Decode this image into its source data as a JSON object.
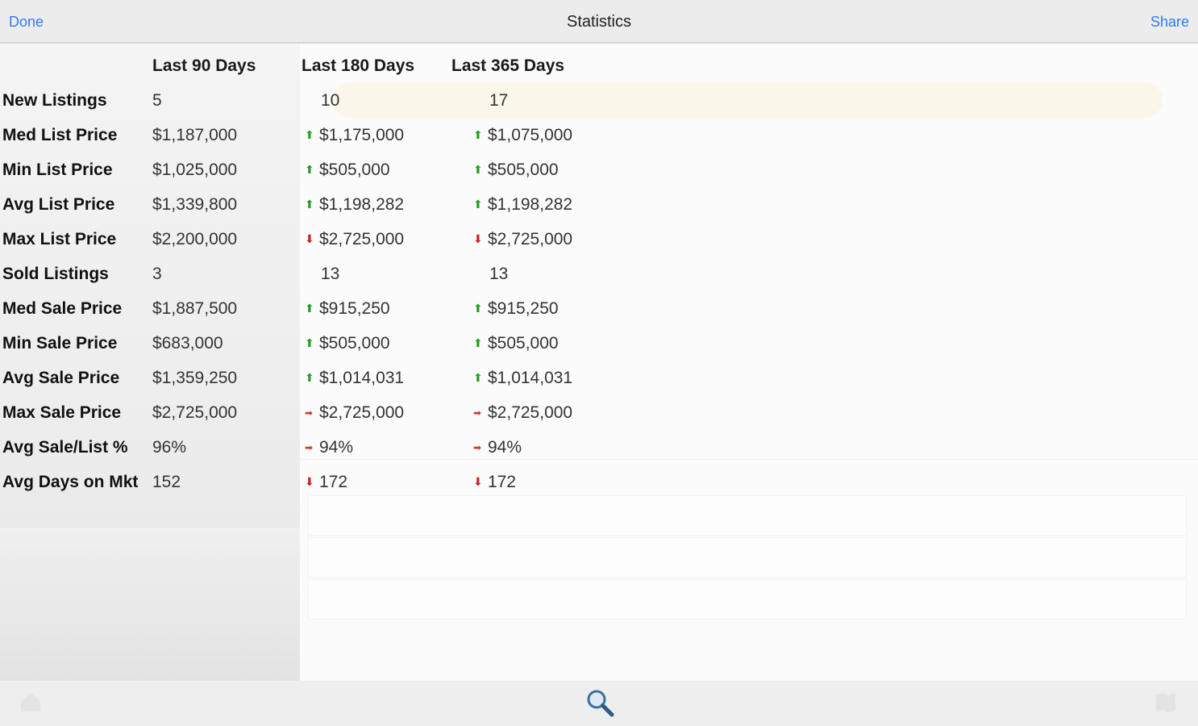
{
  "navbar": {
    "done_label": "Done",
    "title": "Statistics",
    "share_label": "Share",
    "accent_color": "#2f7cf6"
  },
  "stats": {
    "columns": [
      "Last 90 Days",
      "Last 180 Days",
      "Last 365 Days"
    ],
    "rows": [
      {
        "label": "New Listings",
        "d90": "5",
        "d180": "10",
        "d365": "17",
        "t180": "none",
        "t365": "none"
      },
      {
        "label": "Med List Price",
        "d90": "$1,187,000",
        "d180": "$1,175,000",
        "d365": "$1,075,000",
        "t180": "up",
        "t365": "up"
      },
      {
        "label": "Min List Price",
        "d90": "$1,025,000",
        "d180": "$505,000",
        "d365": "$505,000",
        "t180": "up",
        "t365": "up"
      },
      {
        "label": "Avg List Price",
        "d90": "$1,339,800",
        "d180": "$1,198,282",
        "d365": "$1,198,282",
        "t180": "up",
        "t365": "up"
      },
      {
        "label": "Max List Price",
        "d90": "$2,200,000",
        "d180": "$2,725,000",
        "d365": "$2,725,000",
        "t180": "down",
        "t365": "down"
      },
      {
        "label": "Sold Listings",
        "d90": "3",
        "d180": "13",
        "d365": "13",
        "t180": "none",
        "t365": "none"
      },
      {
        "label": "Med Sale Price",
        "d90": "$1,887,500",
        "d180": "$915,250",
        "d365": "$915,250",
        "t180": "up",
        "t365": "up"
      },
      {
        "label": "Min Sale Price",
        "d90": "$683,000",
        "d180": "$505,000",
        "d365": "$505,000",
        "t180": "up",
        "t365": "up"
      },
      {
        "label": "Avg Sale Price",
        "d90": "$1,359,250",
        "d180": "$1,014,031",
        "d365": "$1,014,031",
        "t180": "up",
        "t365": "up"
      },
      {
        "label": "Max Sale Price",
        "d90": "$2,725,000",
        "d180": "$2,725,000",
        "d365": "$2,725,000",
        "t180": "flat",
        "t365": "flat"
      },
      {
        "label": "Avg Sale/List %",
        "d90": "96%",
        "d180": "94%",
        "d365": "94%",
        "t180": "flat",
        "t365": "flat"
      },
      {
        "label": "Avg Days on Mkt",
        "d90": "152",
        "d180": "172",
        "d365": "172",
        "t180": "down",
        "t365": "down"
      }
    ],
    "trend_colors": {
      "up": "#1f9e1f",
      "down": "#cc1e1e",
      "flat": "#d23a2a"
    }
  },
  "bottombar": {
    "icon": "search-icon"
  }
}
